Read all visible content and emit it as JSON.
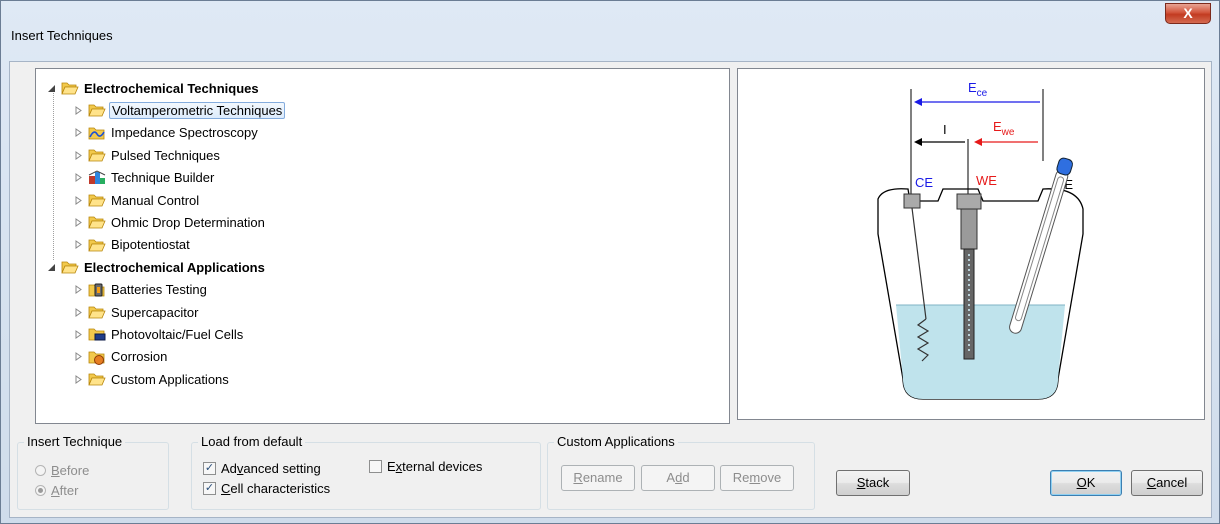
{
  "window": {
    "title": "Insert Techniques",
    "close_glyph": "X"
  },
  "tree": {
    "nodes": [
      {
        "label": "Electrochemical Techniques",
        "level": 0,
        "bold": true,
        "expanded": true,
        "icon": "folder-open-icon"
      },
      {
        "label": "Voltamperometric Techniques",
        "level": 1,
        "selected": true,
        "icon": "folder-open-icon"
      },
      {
        "label": "Impedance Spectroscopy",
        "level": 1,
        "icon": "impedance-icon"
      },
      {
        "label": "Pulsed Techniques",
        "level": 1,
        "icon": "folder-open-icon"
      },
      {
        "label": "Technique Builder",
        "level": 1,
        "icon": "builder-icon"
      },
      {
        "label": "Manual Control",
        "level": 1,
        "icon": "folder-open-icon"
      },
      {
        "label": "Ohmic Drop Determination",
        "level": 1,
        "icon": "folder-open-icon"
      },
      {
        "label": "Bipotentiostat",
        "level": 1,
        "icon": "folder-open-icon"
      },
      {
        "label": "Electrochemical Applications",
        "level": 0,
        "bold": true,
        "expanded": true,
        "icon": "folder-open-icon"
      },
      {
        "label": "Batteries Testing",
        "level": 1,
        "icon": "battery-icon"
      },
      {
        "label": "Supercapacitor",
        "level": 1,
        "icon": "folder-open-icon"
      },
      {
        "label": "Photovoltaic/Fuel Cells",
        "level": 1,
        "icon": "photovoltaic-icon"
      },
      {
        "label": "Corrosion",
        "level": 1,
        "icon": "corrosion-icon"
      },
      {
        "label": "Custom Applications",
        "level": 1,
        "icon": "folder-open-icon"
      }
    ]
  },
  "diagram": {
    "ece_main": "E",
    "ece_sub": "ce",
    "ewe_main": "E",
    "ewe_sub": "we",
    "current": "I",
    "ce": "CE",
    "we": "WE",
    "re": "RE",
    "colors": {
      "blue": "#1a1ae6",
      "red": "#e61a1a",
      "electrolyte": "#bfe3ec",
      "re_tip": "#2f6fe0"
    }
  },
  "insert_technique": {
    "legend": "Insert Technique",
    "before": {
      "prefix": "",
      "mnemonic": "B",
      "rest": "efore",
      "checked": false
    },
    "after": {
      "prefix": "",
      "mnemonic": "A",
      "rest": "fter",
      "checked": true
    }
  },
  "load_default": {
    "legend": "Load from default",
    "advanced": {
      "prefix": "Ad",
      "mnemonic": "v",
      "rest": "anced setting",
      "checked": true
    },
    "cell": {
      "prefix": "",
      "mnemonic": "C",
      "rest": "ell characteristics",
      "checked": true
    },
    "external": {
      "prefix": "E",
      "mnemonic": "x",
      "rest": "ternal devices",
      "checked": false
    },
    "check_glyph": "✓"
  },
  "custom_apps": {
    "legend": "Custom Applications",
    "rename": {
      "prefix": "",
      "mnemonic": "R",
      "rest": "ename"
    },
    "add": {
      "prefix": "A",
      "mnemonic": "d",
      "rest": "d"
    },
    "remove": {
      "prefix": "Re",
      "mnemonic": "m",
      "rest": "ove"
    }
  },
  "buttons": {
    "stack": {
      "prefix": "",
      "mnemonic": "S",
      "rest": "tack"
    },
    "ok": {
      "prefix": "",
      "mnemonic": "O",
      "rest": "K"
    },
    "cancel": {
      "prefix": "",
      "mnemonic": "C",
      "rest": "ancel"
    }
  }
}
